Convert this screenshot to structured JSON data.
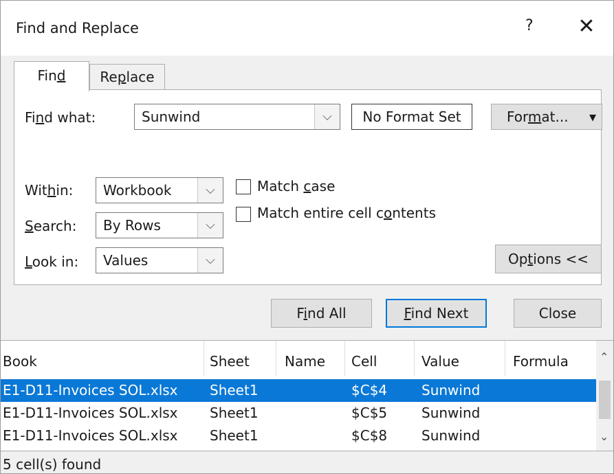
{
  "window": {
    "title": "Find and Replace",
    "help": "?",
    "close": "✕"
  },
  "tabs": {
    "find_pre": "Fin",
    "find_u": "d",
    "replace_pre": "Re",
    "replace_u": "p",
    "replace_post": "lace"
  },
  "find": {
    "label_pre": "Fi",
    "label_u": "n",
    "label_post": "d what:",
    "value": "Sunwind",
    "format_status": "No Format Set",
    "format_btn_pre": "For",
    "format_btn_u": "m",
    "format_btn_post": "at...",
    "format_arrow": "▾"
  },
  "options": {
    "within": {
      "label_pre": "Wit",
      "label_u": "h",
      "label_post": "in:",
      "value": "Workbook"
    },
    "search": {
      "label_u": "S",
      "label_post": "earch:",
      "value": "By Rows"
    },
    "lookin": {
      "label_u": "L",
      "label_post": "ook in:",
      "value": "Values"
    },
    "match_case": {
      "pre": "Match ",
      "u": "c",
      "post": "ase",
      "checked": false
    },
    "match_entire": {
      "pre": "Match entire cell c",
      "u": "o",
      "post": "ntents",
      "checked": false
    },
    "options_btn_pre": "Op",
    "options_btn_u": "t",
    "options_btn_post": "ions <<"
  },
  "buttons": {
    "find_all_pre": "F",
    "find_all_u": "i",
    "find_all_post": "nd All",
    "find_next_u": "F",
    "find_next_post": "ind Next",
    "close": "Close"
  },
  "results": {
    "columns": [
      "Book",
      "Sheet",
      "Name",
      "Cell",
      "Value",
      "Formula"
    ],
    "rows": [
      {
        "book": "E1-D11-Invoices SOL.xlsx",
        "sheet": "Sheet1",
        "name": "",
        "cell": "$C$4",
        "value": "Sunwind",
        "formula": "",
        "selected": true
      },
      {
        "book": "E1-D11-Invoices SOL.xlsx",
        "sheet": "Sheet1",
        "name": "",
        "cell": "$C$5",
        "value": "Sunwind",
        "formula": "",
        "selected": false
      },
      {
        "book": "E1-D11-Invoices SOL.xlsx",
        "sheet": "Sheet1",
        "name": "",
        "cell": "$C$8",
        "value": "Sunwind",
        "formula": "",
        "selected": false
      }
    ]
  },
  "status": "5 cell(s) found",
  "colors": {
    "selection": "#0a78d6",
    "default_button_border": "#0078d7",
    "button_face": "#e1e1e1"
  }
}
